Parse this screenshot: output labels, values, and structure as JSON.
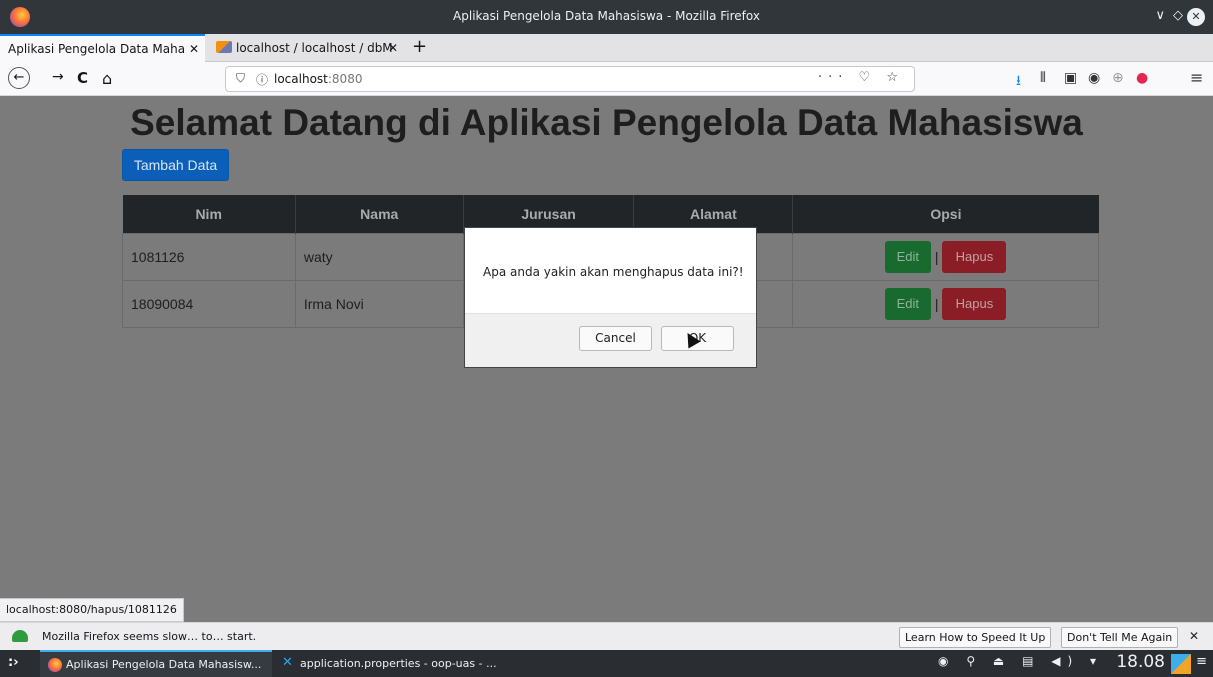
{
  "window": {
    "title": "Aplikasi Pengelola Data Mahasiswa - Mozilla Firefox",
    "controls": {
      "minimize": "∨",
      "maximize": "◇",
      "close": "✕"
    }
  },
  "tabs": [
    {
      "label": "Aplikasi Pengelola Data Maha",
      "active": true,
      "close": "✕"
    },
    {
      "label": "localhost / localhost / dbM",
      "active": false,
      "close": "✕"
    }
  ],
  "new_tab": "+",
  "nav": {
    "back": "←",
    "forward": "→",
    "reload": "C",
    "home": "⌂",
    "url_host": "localhost",
    "url_port": ":8080",
    "shield_icon": "⛉",
    "info_icon": "ⓘ",
    "url_actions": "··· ♡ ☆"
  },
  "toolbar": {
    "download": "⭳",
    "library": "⫴",
    "sidebar": "▣",
    "account": "◉",
    "extension": "⊕",
    "alert": "●",
    "menu": "≡"
  },
  "page": {
    "title": "Selamat Datang di Aplikasi Pengelola Data Mahasiswa",
    "add_button": "Tambah Data",
    "table": {
      "headers": [
        "Nim",
        "Nama",
        "Jurusan",
        "Alamat",
        "Opsi"
      ],
      "rows": [
        {
          "nim": "1081126",
          "nama": "waty",
          "jurusan": "",
          "alamat": ""
        },
        {
          "nim": "18090084",
          "nama": "Irma Novi",
          "jurusan": "",
          "alamat": ""
        }
      ],
      "edit_label": "Edit",
      "separator": "|",
      "delete_label": "Hapus"
    }
  },
  "dialog": {
    "message": "Apa anda yakin akan menghapus data ini?!",
    "cancel": "Cancel",
    "ok": "OK"
  },
  "status_link": "localhost:8080/hapus/1081126",
  "notification": {
    "message": "Mozilla Firefox seems slow… to… start.",
    "learn_button": "Learn How to Speed It Up",
    "dismiss_button": "Don't Tell Me Again",
    "close": "✕"
  },
  "taskbar": {
    "launcher": ":›",
    "tasks": [
      {
        "label": "Aplikasi Pengelola Data Mahasisw...",
        "active": true
      },
      {
        "label": "application.properties - oop-uas - ...",
        "active": false
      }
    ],
    "tray_icons": "◉ ⚲ ⏏ ▤ ◀) ▾",
    "clock": "18.08",
    "menu": "≡"
  },
  "colors": {
    "overlay_bg": "#7b7b7b",
    "primary_btn": "#0c5fb8",
    "edit_btn": "#186a2f",
    "delete_btn": "#8a1d26",
    "table_header": "#222528",
    "accent": "#3daee9"
  }
}
